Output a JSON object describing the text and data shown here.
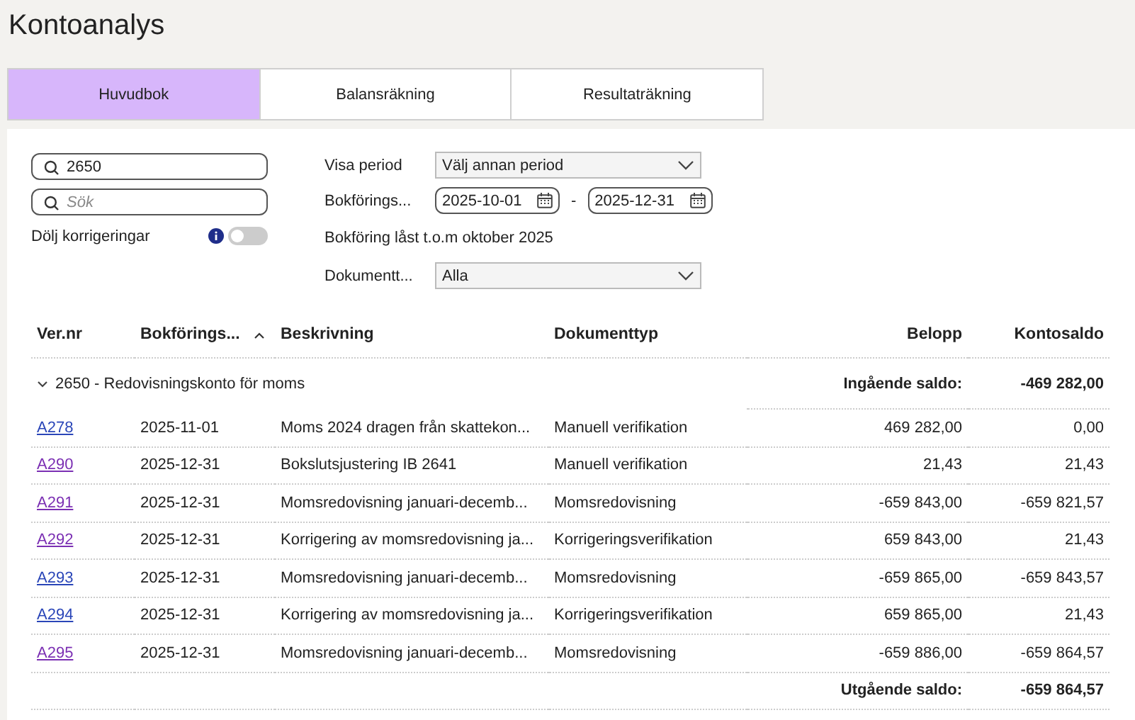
{
  "title": "Kontoanalys",
  "tabs": [
    {
      "label": "Huvudbok",
      "selected": true
    },
    {
      "label": "Balansräkning",
      "selected": false
    },
    {
      "label": "Resultaträkning",
      "selected": false
    }
  ],
  "filters": {
    "account_search": {
      "value": "2650"
    },
    "search": {
      "placeholder": "Sök"
    },
    "hide_corrections": {
      "label": "Dölj korrigeringar",
      "on": false
    },
    "period": {
      "label": "Visa period",
      "value": "Välj annan period"
    },
    "date": {
      "label": "Bokförings...",
      "from": "2025-10-01",
      "separator": "-",
      "to": "2025-12-31"
    },
    "lock_note": "Bokföring låst t.o.m oktober 2025",
    "doctype": {
      "label": "Dokumentt...",
      "value": "Alla"
    }
  },
  "table": {
    "columns": [
      {
        "label": "Ver.nr",
        "sorted": false
      },
      {
        "label": "Bokförings...",
        "sorted": true
      },
      {
        "label": "Beskrivning",
        "sorted": false
      },
      {
        "label": "Dokumenttyp",
        "sorted": false
      },
      {
        "label": "Belopp",
        "sorted": false
      },
      {
        "label": "Kontosaldo",
        "sorted": false
      }
    ],
    "group": {
      "label": "2650 - Redovisningskonto för moms",
      "expanded": true,
      "opening_label": "Ingående saldo:",
      "opening_value": "-469 282,00"
    },
    "rows": [
      {
        "ver": "A278",
        "visited": false,
        "date": "2025-11-01",
        "description": "Moms 2024 dragen från skattekon...",
        "doctype": "Manuell verifikation",
        "amount": "469 282,00",
        "balance": "0,00"
      },
      {
        "ver": "A290",
        "visited": true,
        "date": "2025-12-31",
        "description": "Bokslutsjustering IB 2641",
        "doctype": "Manuell verifikation",
        "amount": "21,43",
        "balance": "21,43"
      },
      {
        "ver": "A291",
        "visited": true,
        "date": "2025-12-31",
        "description": "Momsredovisning januari-decemb...",
        "doctype": "Momsredovisning",
        "amount": "-659 843,00",
        "balance": "-659 821,57"
      },
      {
        "ver": "A292",
        "visited": true,
        "date": "2025-12-31",
        "description": "Korrigering av momsredovisning ja...",
        "doctype": "Korrigeringsverifikation",
        "amount": "659 843,00",
        "balance": "21,43"
      },
      {
        "ver": "A293",
        "visited": false,
        "date": "2025-12-31",
        "description": "Momsredovisning januari-decemb...",
        "doctype": "Momsredovisning",
        "amount": "-659 865,00",
        "balance": "-659 843,57"
      },
      {
        "ver": "A294",
        "visited": false,
        "date": "2025-12-31",
        "description": "Korrigering av momsredovisning ja...",
        "doctype": "Korrigeringsverifikation",
        "amount": "659 865,00",
        "balance": "21,43"
      },
      {
        "ver": "A295",
        "visited": true,
        "date": "2025-12-31",
        "description": "Momsredovisning januari-decemb...",
        "doctype": "Momsredovisning",
        "amount": "-659 886,00",
        "balance": "-659 864,57"
      }
    ],
    "closing_label": "Utgående saldo:",
    "closing_value": "-659 864,57"
  }
}
